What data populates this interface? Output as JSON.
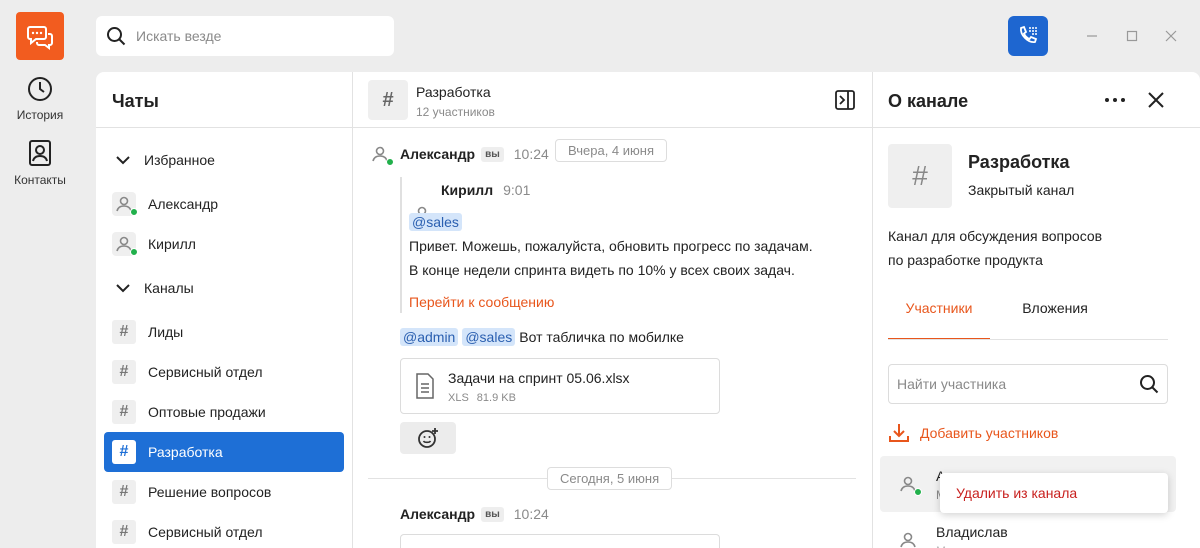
{
  "search": {
    "placeholder": "Искать везде"
  },
  "rail": [
    {
      "label": "История",
      "icon": "clock-icon"
    },
    {
      "label": "Контакты",
      "icon": "contacts-icon"
    }
  ],
  "chats": {
    "title": "Чаты",
    "favorites_label": "Избранное",
    "favorites": [
      "Александр",
      "Кирилл"
    ],
    "channels_label": "Каналы",
    "channels": [
      "Лиды",
      "Сервисный отдел",
      "Оптовые продажи",
      "Разработка",
      "Решение вопросов",
      "Сервисный отдел"
    ],
    "active_channel": "Разработка"
  },
  "conversation": {
    "name": "Разработка",
    "members": "12 участников",
    "date1": "Вчера, 4 июня",
    "date2": "Сегодня, 5 июня",
    "msg1": {
      "author": "Александр",
      "you": "вы",
      "time": "10:24",
      "quote": {
        "author": "Кирилл",
        "time": "9:01",
        "mention": "@sales",
        "line1": "Привет. Можешь, пожалуйста, обновить прогресс по задачам.",
        "line2": "В конце недели спринта видеть по 10% у всех своих задач.",
        "goto": "Перейти к сообщению"
      },
      "mention1": "@admin",
      "mention2": "@sales",
      "text": "Вот табличка по мобилке",
      "file": {
        "name": "Задачи на спринт 05.06.xlsx",
        "type": "XLS",
        "size": "81.9 KB"
      }
    },
    "msg2": {
      "author": "Александр",
      "you": "вы",
      "time": "10:24"
    }
  },
  "info": {
    "title": "О канале",
    "channel_name": "Разработка",
    "channel_type": "Закрытый канал",
    "desc1": "Канал для обсуждения вопросов",
    "desc2": "по разработке продукта",
    "tab_members": "Участники",
    "tab_attachments": "Вложения",
    "member_search_placeholder": "Найти участника",
    "add_members": "Добавить участников",
    "members": [
      "А",
      "Владислав"
    ],
    "member_subs": [
      "М",
      "М"
    ],
    "context_menu": "Удалить из канала"
  },
  "colors": {
    "accent_orange": "#f25c1f",
    "active_blue": "#1e6fd6",
    "online_green": "#21b04b",
    "danger_red": "#c8201e"
  }
}
